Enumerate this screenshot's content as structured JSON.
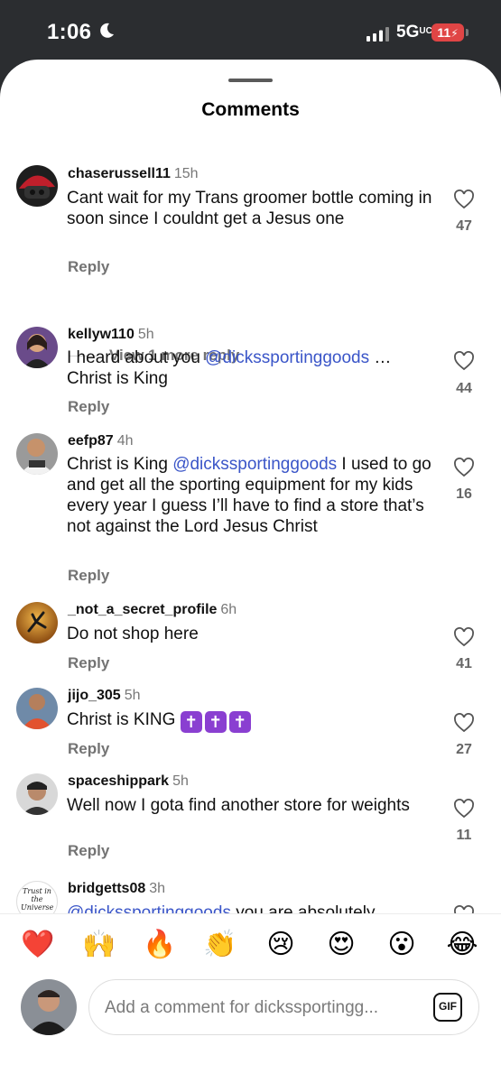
{
  "status_bar": {
    "time": "1:06",
    "network": "5G",
    "network_suffix": "UC",
    "battery": "11"
  },
  "sheet": {
    "title": "Comments"
  },
  "comments": [
    {
      "username": "chaserussell11",
      "age": "15h",
      "text": "Cant wait for my Trans groomer bottle coming in soon since I couldnt get a Jesus one",
      "reply_label": "Reply",
      "likes": "47",
      "view_more": "View 1 more reply"
    },
    {
      "username": "kellyw110",
      "age": "5h",
      "text_before": "I heard about you ",
      "mention": "@dickssportinggoods",
      "text_after": " … Christ is King",
      "reply_label": "Reply",
      "likes": "44"
    },
    {
      "username": "eefp87",
      "age": "4h",
      "text_before": "Christ is King ",
      "mention": "@dickssportinggoods",
      "text_after": " I used to go and get all the sporting equipment for my kids every year I guess I’ll have to find a store that’s not against the Lord Jesus Christ",
      "reply_label": "Reply",
      "likes": "16"
    },
    {
      "username": "_not_a_secret_profile",
      "age": "6h",
      "text": "Do not shop here",
      "reply_label": "Reply",
      "likes": "41"
    },
    {
      "username": "jijo_305",
      "age": "5h",
      "text": "Christ is KING ",
      "emoji": "✝",
      "reply_label": "Reply",
      "likes": "27"
    },
    {
      "username": "spaceshippark",
      "age": "5h",
      "text": "Well now I gota find another store for weights",
      "reply_label": "Reply",
      "likes": "11"
    },
    {
      "username": "bridgetts08",
      "age": "3h",
      "mention": "@dickssportinggoods",
      "text_after": " you are absolutely",
      "avatar_text": "Trust in the Universe"
    }
  ],
  "quick_reactions": [
    "❤️",
    "🙌",
    "🔥",
    "👏",
    "😢",
    "😍",
    "😮",
    "😂"
  ],
  "composer": {
    "placeholder": "Add a comment for dickssportingg...",
    "gif_label": "GIF"
  },
  "colors": {
    "mention": "#3a55c8",
    "battery": "#e04545",
    "cross_emoji": "#8a3fd1"
  }
}
